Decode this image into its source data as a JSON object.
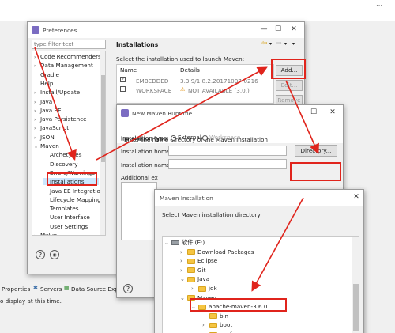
{
  "preferences": {
    "title": "Preferences",
    "filter_placeholder": "type filter text",
    "tree": [
      "Code Recommenders",
      "Data Management",
      "Gradle",
      "Help",
      "Install/Update",
      "Java",
      "Java EE",
      "Java Persistence",
      "JavaScript",
      "JSON",
      "Maven"
    ],
    "maven_children": [
      "Archetypes",
      "Discovery",
      "Errors/Warnings",
      "Installations",
      "Java EE Integratio",
      "Lifecycle Mapping",
      "Templates",
      "User Interface",
      "User Settings"
    ],
    "tree_after": "Mylyn",
    "page_title": "Installations",
    "page_desc": "Select the installation used to launch Maven:",
    "col_name": "Name",
    "col_details": "Details",
    "rows": [
      {
        "name": "EMBEDDED",
        "details": "3.3.9/1.8.2.20171007-0216"
      },
      {
        "name": "WORKSPACE",
        "details": "NOT AVAILABLE [3.0,)"
      }
    ],
    "add_label": "Add...",
    "edit_label": "Edit...",
    "remove_label": "Remove"
  },
  "new_runtime": {
    "title": "New Maven Runtime",
    "desc": "Enter the home directory of the Maven Installation",
    "type_label": "Installation type:",
    "external_label": "External",
    "workspace_label": "Workspace",
    "home_label": "Installation home:",
    "name_label": "Installation name:",
    "extra_label": "Additional ex",
    "directory_label": "Directory..."
  },
  "maven_install": {
    "title": "Maven Installation",
    "desc": "Select Maven installation directory",
    "tree": [
      {
        "label": "软件 (E:)",
        "kind": "drive"
      },
      {
        "label": "Download Packages",
        "kind": "folder"
      },
      {
        "label": "Eclipse",
        "kind": "folder"
      },
      {
        "label": "Git",
        "kind": "folder"
      },
      {
        "label": "Java",
        "kind": "folder"
      },
      {
        "label": "jdk",
        "kind": "folder"
      },
      {
        "label": "Maven",
        "kind": "folder"
      },
      {
        "label": "apache-maven-3.6.0",
        "kind": "folder"
      },
      {
        "label": "bin",
        "kind": "folder"
      },
      {
        "label": "boot",
        "kind": "folder"
      },
      {
        "label": "conf",
        "kind": "folder"
      }
    ]
  },
  "bottom_bar": {
    "tabs": [
      "Properties",
      "Servers",
      "Data Source Explo"
    ],
    "message": "o display at this time."
  },
  "colors": {
    "annotation": "#e0241c",
    "selection": "#cce8ff",
    "folder": "#f5c542"
  }
}
